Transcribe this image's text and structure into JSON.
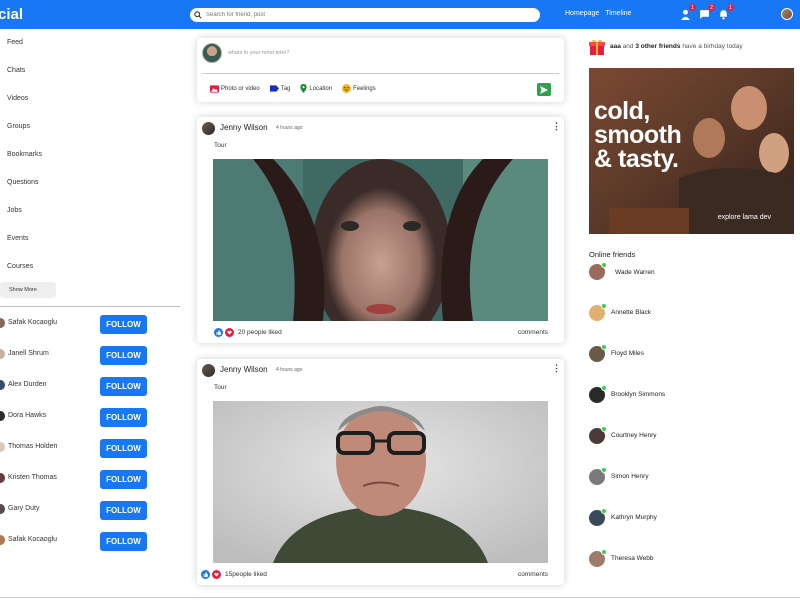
{
  "topbar": {
    "logo": "cial",
    "search_placeholder": "Search for friend, post",
    "links": [
      "Homepage",
      "Timeline"
    ],
    "icons": [
      {
        "name": "person-icon",
        "badge": "1"
      },
      {
        "name": "chat-icon",
        "badge": "2"
      },
      {
        "name": "notifications-icon",
        "badge": "1"
      }
    ]
  },
  "sidebar": {
    "items": [
      "Feed",
      "Chats",
      "Videos",
      "Groups",
      "Bookmarks",
      "Questions",
      "Jobs",
      "Events",
      "Courses"
    ],
    "show_more": "Show More",
    "follow_label": "FOLLOW",
    "friends": [
      "Safak Kocaoglu",
      "Janell Shrum",
      "Alex Durden",
      "Dora Hawks",
      "Thomas Holden",
      "Kristen Thomas",
      "Gary Duty",
      "Safak Kocaoglu"
    ]
  },
  "share": {
    "placeholder": "whats in your mind tetre?",
    "options": [
      "Photo or video",
      "Tag",
      "Location",
      "Feelings"
    ]
  },
  "posts": [
    {
      "author": "Jenny Wilson",
      "time": "4 hours ago",
      "text": "Tour",
      "likes": "20 people liked",
      "comments": "comments"
    },
    {
      "author": "Jenny Wilson",
      "time": "4 hours ago",
      "text": "Tour",
      "likes": "15people liked",
      "comments": "comments"
    }
  ],
  "right": {
    "birthday_name": "aaa",
    "birthday_and": "and",
    "birthday_others": "3 other friends",
    "birthday_text": "have a birhday today",
    "ad_text": [
      "cold,",
      "smooth",
      "& tasty."
    ],
    "ad_footer": "explore lama dev",
    "online_title": "Online friends",
    "online": [
      "Wade Warren",
      "Annette Black",
      "Floyd Miles",
      "Brooklyn Simmons",
      "Courtney Henry",
      "Simon Henry",
      "Kathryn Murphy",
      "Theresa Webb"
    ]
  },
  "colors": {
    "brand": "#1877f2",
    "online": "#32d44a",
    "badge": "#e41e3f",
    "send": "#2ea24a"
  }
}
